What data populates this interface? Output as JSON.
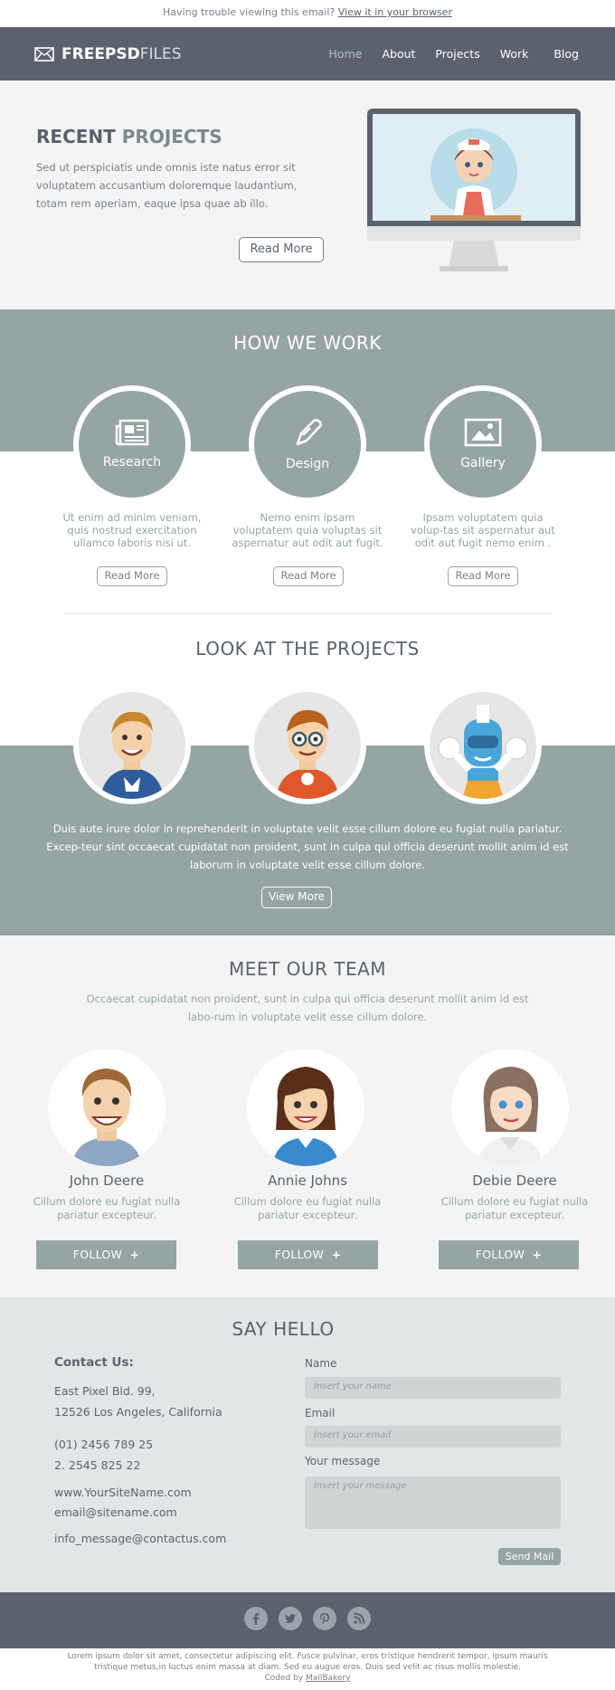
{
  "topbar": {
    "text": "Having trouble viewing this email?",
    "link": "View it in your browser"
  },
  "logo": {
    "bold": "FREEPSD",
    "light": "FILES"
  },
  "nav": [
    "Home",
    "About",
    "Projects",
    "Work",
    "Blog"
  ],
  "hero": {
    "title_a": "RECENT",
    "title_b": "PROJECTS",
    "text": "Sed ut perspiciatis unde omnis iste natus error sit voluptatem accusantium doloremque laudantium, totam rem aperiam, eaque ipsa quae ab illo.",
    "button": "Read More"
  },
  "how": {
    "title": "HOW WE WORK",
    "items": [
      {
        "label": "Research",
        "icon": "newspaper-icon",
        "text": "Ut enim ad minim veniam, quis nostrud exercitation ullamco laboris nisi ut.",
        "button": "Read More"
      },
      {
        "label": "Design",
        "icon": "pen-icon",
        "text": "Nemo enim ipsam voluptatem quia voluptas sit aspernatur aut odit aut fugit.",
        "button": "Read More"
      },
      {
        "label": "Gallery",
        "icon": "image-icon",
        "text": "Ipsam voluptatem quia volup-tas sit aspernatur aut odit aut fugit nemo enim .",
        "button": "Read More"
      }
    ]
  },
  "projects": {
    "title": "LOOK AT THE PROJECTS",
    "text": "Duis aute irure dolor in reprehenderit in voluptate velit esse cillum dolore eu fugiat nulla pariatur. Excep-teur sint occaecat cupidatat non proident, sunt in culpa qui officia deserunt mollit anim id est laborum  in voluptate velit esse cillum dolore.",
    "button": "View More"
  },
  "team": {
    "title": "MEET OUR TEAM",
    "text": "Occaecat cupidatat non proident, sunt in culpa qui officia deserunt mollit anim id est labo-rum  in voluptate velit esse cillum dolore.",
    "members": [
      {
        "name": "John Deere",
        "role": "Cillum dolore eu fugiat nulla pariatur excepteur.",
        "button": "FOLLOW"
      },
      {
        "name": "Annie Johns",
        "role": "Cillum dolore eu fugiat nulla pariatur excepteur.",
        "button": "FOLLOW"
      },
      {
        "name": "Debie Deere",
        "role": "Cillum dolore eu fugiat nulla pariatur excepteur.",
        "button": "FOLLOW"
      }
    ]
  },
  "hello": {
    "title": "SAY HELLO",
    "contact_title": "Contact Us:",
    "address1": "East Pixel Bld. 99,",
    "address2": "12526 Los Angeles, California",
    "phone1": "(01) 2456 789 25",
    "phone2": "2. 2545 825 22",
    "site": "www.YourSiteName.com",
    "email": "email@sitename.com",
    "info": "info_message@contactus.com",
    "name_label": "Name",
    "name_placeholder": "Insert your name",
    "email_label": "Email",
    "email_placeholder": "Insert your email",
    "message_label": "Your message",
    "message_placeholder": "Insert your message",
    "send": "Send Mail"
  },
  "footer": {
    "social": [
      "facebook-icon",
      "twitter-icon",
      "pinterest-icon",
      "rss-icon"
    ],
    "text": "Lorem ipsum dolor sit amet, consectetur adipiscing elit. Fusce pulvinar, eros tristique hendrerit tempor, ipsum mauris tristique metus,in luctus enim massa at diam. Sed eu augue eros. Duis sed velit ac risus mollis molestie.",
    "coded_by": "Coded by",
    "coded_link": "MailBakery"
  },
  "colors": {
    "dark": "#5b626d",
    "accent": "#95a5a4",
    "light": "#f4f4f4",
    "hello_bg": "#e1e6e6"
  }
}
